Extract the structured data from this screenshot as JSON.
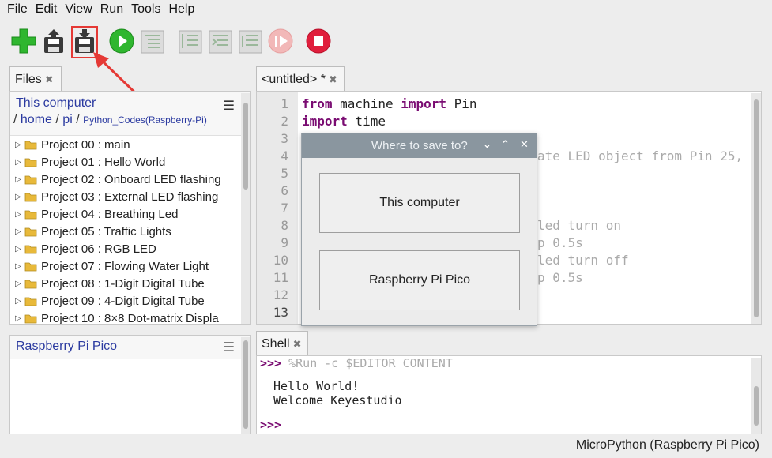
{
  "menu": [
    "File",
    "Edit",
    "View",
    "Run",
    "Tools",
    "Help"
  ],
  "toolbar": {
    "buttons": [
      {
        "name": "new-button",
        "icon": "plus-icon"
      },
      {
        "name": "open-button",
        "icon": "open-disk-icon"
      },
      {
        "name": "save-button",
        "icon": "save-disk-icon"
      },
      {
        "name": "run-button",
        "icon": "play-icon"
      },
      {
        "name": "debug-button",
        "icon": "debug-icon"
      },
      {
        "name": "step-over-button",
        "icon": "step-over-icon"
      },
      {
        "name": "step-into-button",
        "icon": "step-into-icon"
      },
      {
        "name": "step-out-button",
        "icon": "step-out-icon"
      },
      {
        "name": "resume-button",
        "icon": "resume-icon"
      },
      {
        "name": "stop-button",
        "icon": "stop-icon"
      }
    ],
    "colors": {
      "green": "#2fb62f",
      "red": "#e01e3c",
      "annotation": "#e53935"
    }
  },
  "files_tab": {
    "label": "Files"
  },
  "files": {
    "location": "This computer",
    "breadcrumb": {
      "sep": "/",
      "parts": [
        "home",
        "pi",
        "Python_Codes(Raspberry-Pi)"
      ]
    },
    "items": [
      "Project 00 : main",
      "Project 01 : Hello World",
      "Project 02 : Onboard LED flashing",
      "Project 03 : External LED flashing",
      "Project 04 : Breathing Led",
      "Project 05 : Traffic Lights",
      "Project 06 : RGB LED",
      "Project 07 : Flowing Water Light",
      "Project 08 : 1-Digit Digital Tube",
      "Project 09 : 4-Digit Digital Tube",
      "Project 10 : 8×8 Dot-matrix Displa"
    ]
  },
  "pico": {
    "location": "Raspberry Pi Pico"
  },
  "editor_tab": {
    "label": "<untitled> *"
  },
  "editor": {
    "line_numbers": [
      "1",
      "2",
      "3",
      "4",
      "5",
      "6",
      "7",
      "8",
      "9",
      "10",
      "11",
      "12",
      "13"
    ],
    "line1": {
      "kw1": "from",
      "mid": " machine ",
      "kw2": "import",
      "rest": " Pin"
    },
    "line2": {
      "kw1": "import",
      "rest": " time"
    },
    "line4_visible": "ate LED object from Pin 25,",
    "line8_visible": "led turn on",
    "line9_visible": "p 0.5s",
    "line10_visible": "led turn off",
    "line11_visible": "p 0.5s"
  },
  "dialog": {
    "title": "Where to save to?",
    "option1": "This computer",
    "option2": "Raspberry Pi Pico"
  },
  "shell_tab": {
    "label": "Shell"
  },
  "shell": {
    "prompt": ">>>",
    "command": " %Run -c $EDITOR_CONTENT",
    "output": [
      "Hello World!",
      "Welcome Keyestudio"
    ]
  },
  "status": {
    "interpreter": "MicroPython (Raspberry Pi Pico)"
  }
}
